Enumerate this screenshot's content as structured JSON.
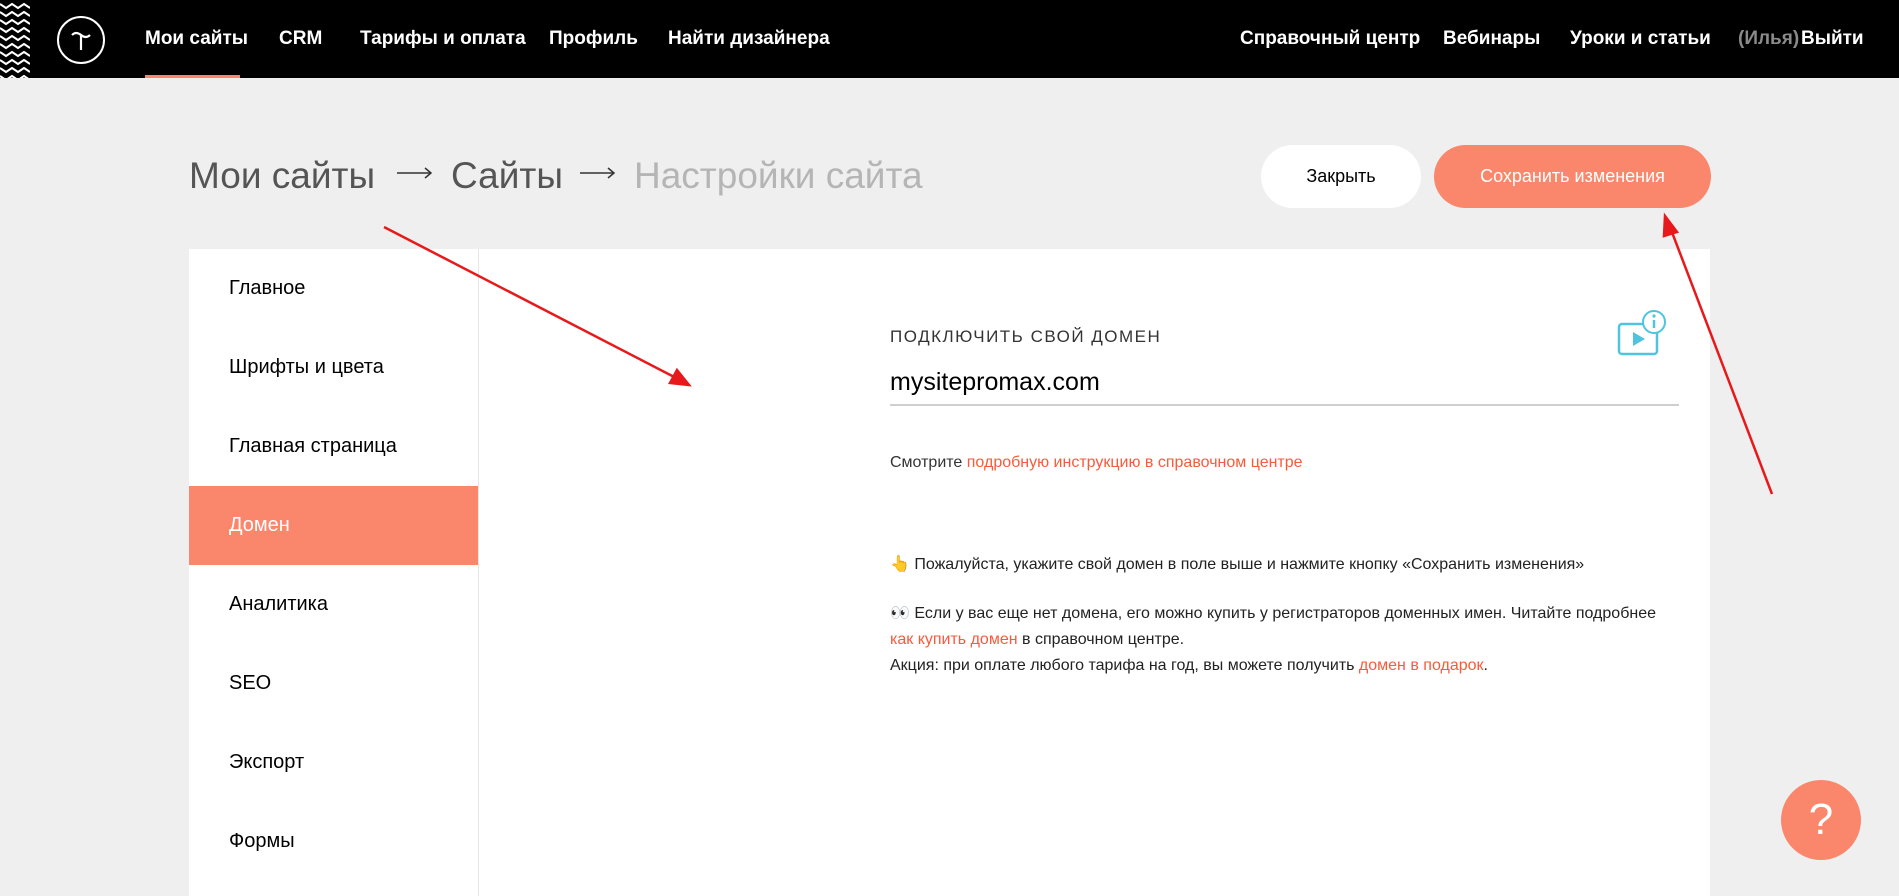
{
  "topnav": {
    "left": [
      {
        "label": "Мои сайты",
        "active": true
      },
      {
        "label": "CRM"
      },
      {
        "label": "Тарифы и оплата"
      },
      {
        "label": "Профиль"
      },
      {
        "label": "Найти дизайнера"
      }
    ],
    "right": {
      "help_center": "Справочный центр",
      "webinars": "Вебинары",
      "lessons": "Уроки и статьи",
      "user": "(Илья)",
      "logout": "Выйти"
    }
  },
  "breadcrumb": {
    "item1": "Мои сайты",
    "item2": "Сайты",
    "current": "Настройки сайта"
  },
  "actions": {
    "close": "Закрыть",
    "save": "Сохранить изменения"
  },
  "sidebar": {
    "items": [
      {
        "label": "Главное"
      },
      {
        "label": "Шрифты и цвета"
      },
      {
        "label": "Главная страница"
      },
      {
        "label": "Домен",
        "active": true
      },
      {
        "label": "Аналитика"
      },
      {
        "label": "SEO"
      },
      {
        "label": "Экспорт"
      },
      {
        "label": "Формы"
      }
    ]
  },
  "domain": {
    "label": "ПОДКЛЮЧИТЬ СВОЙ ДОМЕН",
    "value": "mysitepromax.com",
    "hint_prefix": "Смотрите ",
    "hint_link": "подробную инструкцию в справочном центре",
    "note1_icon": "👆",
    "note1": "Пожалуйста, укажите свой домен в поле выше и нажмите кнопку «Сохранить изменения»",
    "note2_icon": "👀",
    "note2_text": "Если у вас еще нет домена, его можно купить у регистраторов доменных имен. Читайте подробнее",
    "note2_link": "как купить домен",
    "note2_suffix": " в справочном центре.",
    "promo_text": "Акция: при оплате любого тарифа на год, вы можете получить ",
    "promo_link": "домен в подарок",
    "promo_end": "."
  },
  "help_button": "?",
  "colors": {
    "accent": "#fa876b",
    "link": "#fa5a3b",
    "annotation": "#e8191b",
    "video_icon": "#4fc3e0"
  },
  "icons": [
    "tilda-logo-icon",
    "arrow-right-icon",
    "video-info-icon",
    "question-icon"
  ]
}
